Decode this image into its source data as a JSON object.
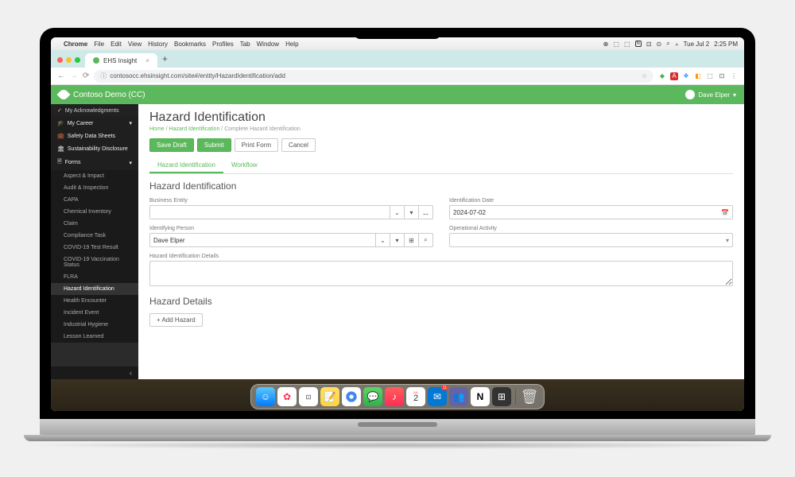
{
  "menubar": {
    "app": "Chrome",
    "items": [
      "File",
      "Edit",
      "View",
      "History",
      "Bookmarks",
      "Profiles",
      "Tab",
      "Window",
      "Help"
    ],
    "date": "Tue Jul 2",
    "time": "2:25 PM"
  },
  "browser": {
    "tab_title": "EHS Insight",
    "url": "contosocc.ehsinsight.com/site#/entity/HazardIdentification/add"
  },
  "header": {
    "org": "Contoso Demo (CC)",
    "user": "Dave Elper"
  },
  "sidebar": {
    "top": "My Acknowledgments",
    "sections": [
      {
        "label": "My Career",
        "icon": "graduation-icon",
        "expandable": true
      },
      {
        "label": "Safety Data Sheets",
        "icon": "briefcase-icon"
      },
      {
        "label": "Sustainability Disclosure",
        "icon": "building-icon"
      },
      {
        "label": "Forms",
        "icon": "document-icon",
        "expandable": true
      }
    ],
    "forms": [
      "Aspect & Impact",
      "Audit & Inspection",
      "CAPA",
      "Chemical Inventory",
      "Claim",
      "Compliance Task",
      "COVID-19 Test Result",
      "COVID-19 Vaccination Status",
      "FLRA",
      "Hazard Identification",
      "Health Encounter",
      "Incident Event",
      "Industrial Hygiene",
      "Lesson Learned"
    ],
    "active_form": "Hazard Identification"
  },
  "page": {
    "title": "Hazard Identification",
    "crumbs": {
      "home": "Home",
      "mid": "Hazard Identification",
      "cur": "Complete Hazard Identification"
    },
    "buttons": {
      "save": "Save Draft",
      "submit": "Submit",
      "print": "Print Form",
      "cancel": "Cancel"
    },
    "tabs": {
      "a": "Hazard Identification",
      "b": "Workflow"
    },
    "section1": "Hazard Identification",
    "fields": {
      "entity_label": "Business Entity",
      "entity_value": "",
      "date_label": "Identification Date",
      "date_value": "2024-07-02",
      "person_label": "Identifying Person",
      "person_value": "Dave Elper",
      "activity_label": "Operational Activity",
      "activity_value": "",
      "details_label": "Hazard Identification Details"
    },
    "section2": "Hazard Details",
    "add_hazard": "+ Add Hazard"
  },
  "dock": {
    "apps": [
      "finder",
      "photos",
      "reminders",
      "notes",
      "chrome",
      "messages",
      "music",
      "calendar",
      "outlook",
      "teams",
      "notion",
      "calculator"
    ],
    "cal_day": "2",
    "cal_mon": "JUL",
    "badge": "11"
  }
}
